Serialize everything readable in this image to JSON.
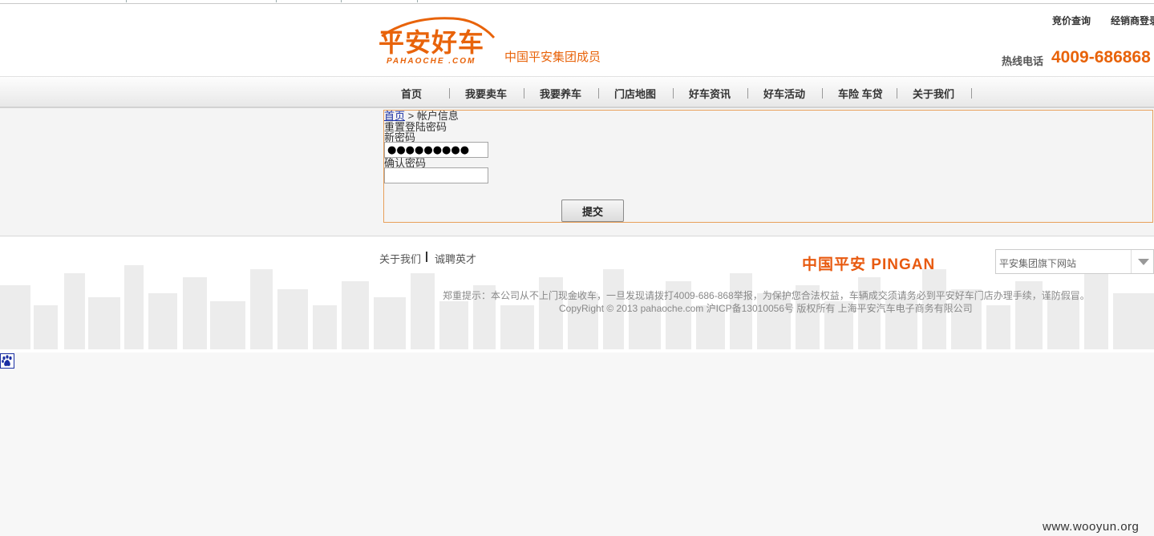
{
  "brand": {
    "logo_text": "平安好车",
    "logo_sub": "PAHAOCHE .COM",
    "slogan": "中国平安集团成员"
  },
  "top_links": {
    "bid_query": "竞价查询",
    "dealer_login": "经销商登录"
  },
  "hotline": {
    "label": "热线电话",
    "number": "4009-686868"
  },
  "nav": {
    "items": [
      {
        "label": "首页"
      },
      {
        "label": "我要卖车"
      },
      {
        "label": "我要养车"
      },
      {
        "label": "门店地图"
      },
      {
        "label": "好车资讯"
      },
      {
        "label": "好车活动"
      },
      {
        "label": "车险 车贷"
      },
      {
        "label": "关于我们"
      }
    ]
  },
  "breadcrumb": {
    "home": "首页",
    "separator": ">",
    "current": "帐户信息"
  },
  "form": {
    "title": "重置登陆密码",
    "new_password_label": "新密码",
    "new_password_value": "●●●●●●●●●",
    "confirm_password_label": "确认密码",
    "confirm_password_value": "",
    "submit_label": "提交"
  },
  "footer": {
    "about_label": "关于我们",
    "careers_label": "诚聘英才",
    "pingan_logo": "中国平安 PINGAN",
    "sites_select": "平安集团旗下网站",
    "notice": "郑重提示：本公司从不上门现金收车，一旦发现请拨打4009-686-868举报，为保护您合法权益，车辆成交须请务必到平安好车门店办理手续，谨防假冒。",
    "copyright": "CopyRight © 2013 pahaoche.com 沪ICP备13010056号 版权所有 上海平安汽车电子商务有限公司"
  },
  "watermark": "www.wooyun.org",
  "colors": {
    "brand_orange": "#e8630a",
    "panel_border": "#e8a05a",
    "link_blue": "#1a2fa3"
  }
}
